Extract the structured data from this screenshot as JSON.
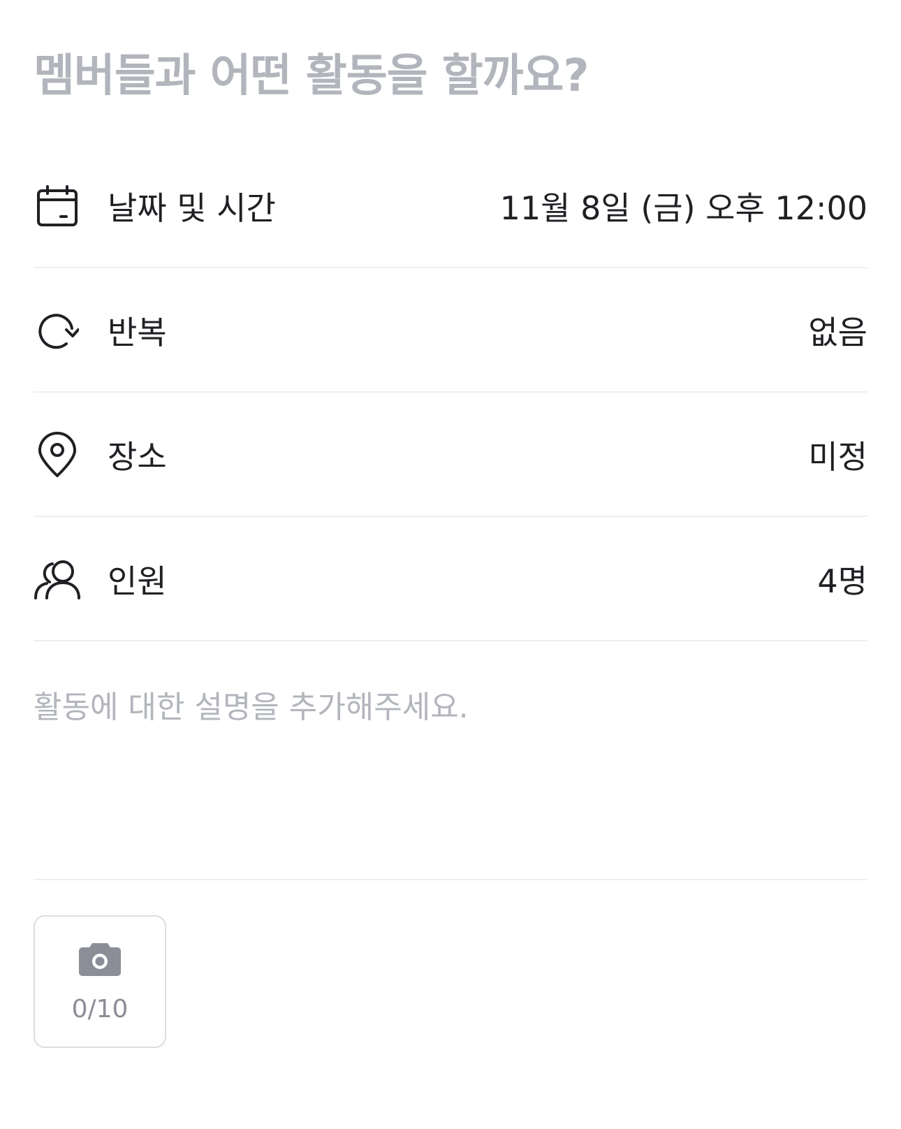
{
  "title_input": {
    "placeholder": "멤버들과 어떤 활동을 할까요?"
  },
  "rows": [
    {
      "icon": "calendar-icon",
      "label": "날짜 및 시간",
      "value": "11월 8일 (금) 오후 12:00"
    },
    {
      "icon": "repeat-icon",
      "label": "반복",
      "value": "없음"
    },
    {
      "icon": "location-pin-icon",
      "label": "장소",
      "value": "미정"
    },
    {
      "icon": "people-icon",
      "label": "인원",
      "value": "4명"
    }
  ],
  "description": {
    "placeholder": "활동에 대한 설명을 추가해주세요."
  },
  "photo": {
    "icon": "camera-icon",
    "count_label": "0/10"
  },
  "colors": {
    "placeholder": "#b2b5bc",
    "text": "#1f2024",
    "divider": "#efeff1",
    "icon_gray": "#8b8e96"
  }
}
